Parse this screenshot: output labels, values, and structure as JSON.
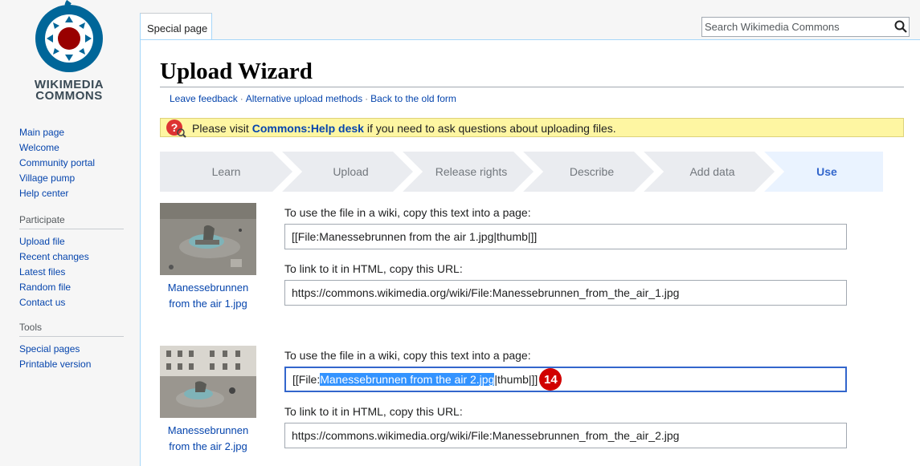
{
  "logo": {
    "line1": "WIKIMEDIA",
    "line2": "COMMONS"
  },
  "nav_sections": [
    {
      "items": [
        "Main page",
        "Welcome",
        "Community portal",
        "Village pump",
        "Help center"
      ]
    },
    {
      "heading": "Participate",
      "items": [
        "Upload file",
        "Recent changes",
        "Latest files",
        "Random file",
        "Contact us"
      ]
    },
    {
      "heading": "Tools",
      "items": [
        "Special pages",
        "Printable version"
      ]
    }
  ],
  "header": {
    "tab_label": "Special page",
    "search_placeholder": "Search Wikimedia Commons"
  },
  "page": {
    "title": "Upload Wizard",
    "links": [
      "Leave feedback",
      "Alternative upload methods",
      "Back to the old form"
    ],
    "notice": {
      "before": "Please visit ",
      "link": "Commons:Help desk",
      "after": " if you need to ask questions about uploading files."
    }
  },
  "steps": [
    "Learn",
    "Upload",
    "Release rights",
    "Describe",
    "Add data",
    "Use"
  ],
  "active_step": "Use",
  "files": [
    {
      "caption_line1": "Manessebrunnen",
      "caption_line2": "from the air 1.jpg",
      "wiki_label": "To use the file in a wiki, copy this text into a page:",
      "wiki_text": "[[File:Manessebrunnen from the air 1.jpg|thumb|]]",
      "html_label": "To link to it in HTML, copy this URL:",
      "url": "https://commons.wikimedia.org/wiki/File:Manessebrunnen_from_the_air_1.jpg"
    },
    {
      "caption_line1": "Manessebrunnen",
      "caption_line2": "from the air 2.jpg",
      "wiki_label": "To use the file in a wiki, copy this text into a page:",
      "wiki_prefix": "[[File:",
      "wiki_selected": "Manessebrunnen from the air 2.jpg",
      "wiki_suffix": "|thumb|]]",
      "badge": "14",
      "html_label": "To link to it in HTML, copy this URL:",
      "url": "https://commons.wikimedia.org/wiki/File:Manessebrunnen_from_the_air_2.jpg"
    }
  ],
  "colors": {
    "link": "#0645ad",
    "active_step": "#3366cc",
    "selection": "#3393ff",
    "badge": "#d10000",
    "notice_bg": "#fef6a2"
  }
}
